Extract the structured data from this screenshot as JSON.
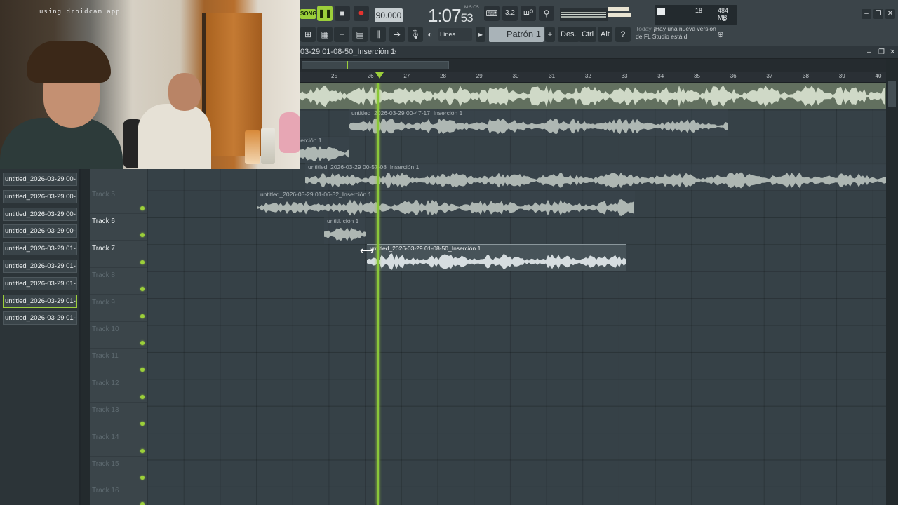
{
  "webcam": {
    "watermark": "using droidcam app"
  },
  "toolbar": {
    "song_badge": "SONG",
    "tempo": "90.000",
    "time_main": "1:07",
    "time_sub": "53",
    "time_unit": "M:S:CS",
    "cpu_value": "18",
    "memory": "484 MB",
    "polyphony": "2",
    "snap_mode": "Línea",
    "pattern": "Patrón 1",
    "pattern_add": "+",
    "hint_des": "Des.",
    "hint_ctrl": "Ctrl",
    "hint_alt": "Alt",
    "news_today": "Today",
    "news_text": "¡Hay una nueva versión de FL Studio está d."
  },
  "playlist": {
    "title": "03-29 01-08-50_Inserción 1",
    "bar_numbers": [
      "25",
      "26",
      "27",
      "28",
      "29",
      "30",
      "31",
      "32",
      "33",
      "34",
      "35",
      "36",
      "37",
      "38",
      "39",
      "40"
    ],
    "clips": [
      {
        "label": "",
        "kind": "main"
      },
      {
        "label": "untitled_2026-03-29 00-47-17_Inserción 1",
        "kind": "audio"
      },
      {
        "label": "serción 1",
        "kind": "audio"
      },
      {
        "label": "untitled_2026-03-29 00-57-08_Inserción 1",
        "kind": "audio"
      },
      {
        "label": "untitled_2026-03-29 01-06-32_Inserción 1",
        "kind": "audio"
      },
      {
        "label": "untitl..ción 1",
        "kind": "audio"
      },
      {
        "label": "untitled_2026-03-29 01-08-50_Inserción 1",
        "kind": "active"
      }
    ]
  },
  "picker": {
    "items": [
      "untitled_2026-03-29 00-...",
      "untitled_2026-03-29 00-...",
      "untitled_2026-03-29 00-...",
      "untitled_2026-03-29 00-...",
      "untitled_2026-03-29 01-...",
      "untitled_2026-03-29 01-...",
      "untitled_2026-03-29 01-...",
      "untitled_2026-03-29 01-...",
      "untitled_2026-03-29 01-..."
    ],
    "selected_index": 7
  },
  "tracks": [
    {
      "name": "Track 5",
      "dim": true
    },
    {
      "name": "Track 6",
      "dim": false
    },
    {
      "name": "Track 7",
      "dim": false
    },
    {
      "name": "Track 8",
      "dim": true
    },
    {
      "name": "Track 9",
      "dim": true
    },
    {
      "name": "Track 10",
      "dim": true
    },
    {
      "name": "Track 11",
      "dim": true
    },
    {
      "name": "Track 12",
      "dim": true
    },
    {
      "name": "Track 13",
      "dim": true
    },
    {
      "name": "Track 14",
      "dim": true
    },
    {
      "name": "Track 15",
      "dim": true
    },
    {
      "name": "Track 16",
      "dim": true
    }
  ],
  "colors": {
    "accent": "#9ccf3a",
    "record": "#e2332f",
    "background": "#364147"
  },
  "icons": {
    "play": "pause-icon",
    "stop": "stop-icon",
    "record": "record-icon"
  }
}
